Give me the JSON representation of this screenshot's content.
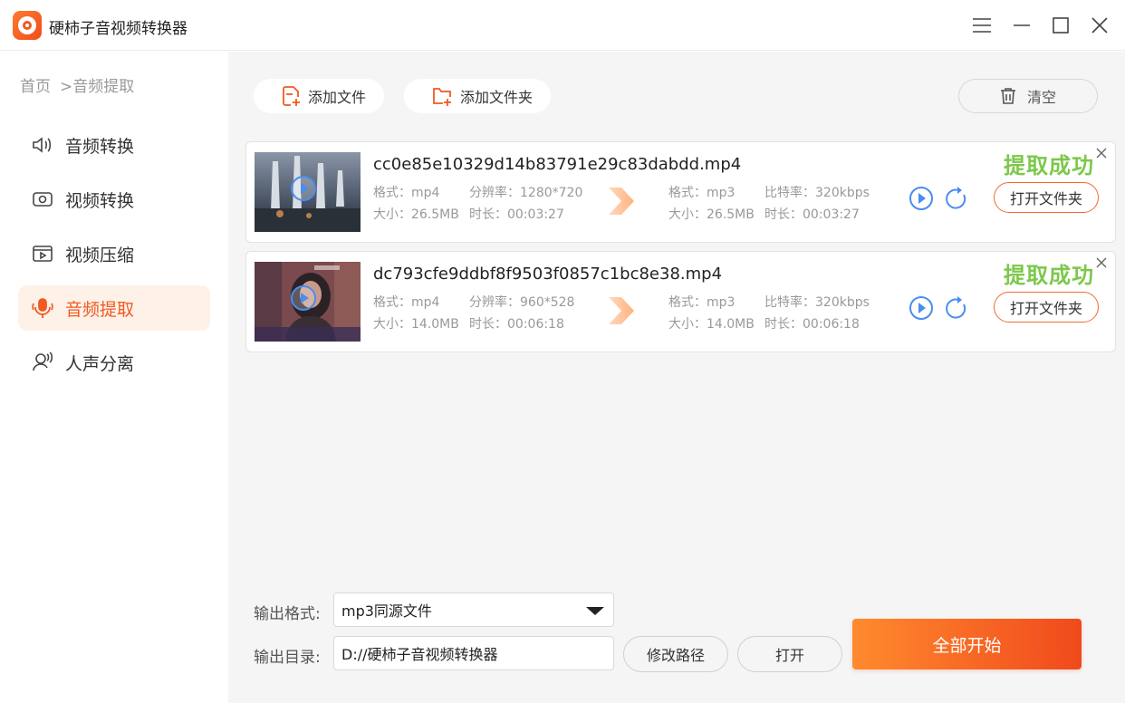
{
  "app": {
    "title": "硬柿子音视频转换器"
  },
  "breadcrumb": {
    "home": "首页",
    "current": ">音频提取"
  },
  "sidebar": {
    "items": [
      {
        "label": "音频转换",
        "icon": "audio-convert-icon"
      },
      {
        "label": "视频转换",
        "icon": "video-convert-icon"
      },
      {
        "label": "视频压缩",
        "icon": "video-compress-icon"
      },
      {
        "label": "音频提取",
        "icon": "audio-extract-icon",
        "active": true
      },
      {
        "label": "人声分离",
        "icon": "voice-separate-icon"
      }
    ]
  },
  "toolbar": {
    "add_file": "添加文件",
    "add_folder": "添加文件夹",
    "clear": "清空"
  },
  "files": [
    {
      "name": "cc0e85e10329d14b83791e29c83dabdd.mp4",
      "src_format": "格式：mp4",
      "src_resolution": "分辨率：1280*720",
      "src_size": "大小：26.5MB",
      "src_duration": "时长：00:03:27",
      "dst_format": "格式：mp3",
      "dst_bitrate": "比特率：320kbps",
      "dst_size": "大小：26.5MB",
      "dst_duration": "时长：00:03:27",
      "status": "提取成功",
      "open_folder": "打开文件夹"
    },
    {
      "name": "dc793cfe9ddbf8f9503f0857c1bc8e38.mp4",
      "src_format": "格式：mp4",
      "src_resolution": "分辨率：960*528",
      "src_size": "大小：14.0MB",
      "src_duration": "时长：00:06:18",
      "dst_format": "格式：mp3",
      "dst_bitrate": "比特率：320kbps",
      "dst_size": "大小：14.0MB",
      "dst_duration": "时长：00:06:18",
      "status": "提取成功",
      "open_folder": "打开文件夹"
    }
  ],
  "output": {
    "format_label": "输出格式:",
    "format_value": "mp3同源文件",
    "dir_label": "输出目录:",
    "dir_value": "D://硬柿子音视频转换器",
    "change_path": "修改路径",
    "open": "打开",
    "start_all": "全部开始"
  },
  "colors": {
    "accent": "#f05a22",
    "success": "#7cc84b",
    "play": "#4a8df0"
  }
}
